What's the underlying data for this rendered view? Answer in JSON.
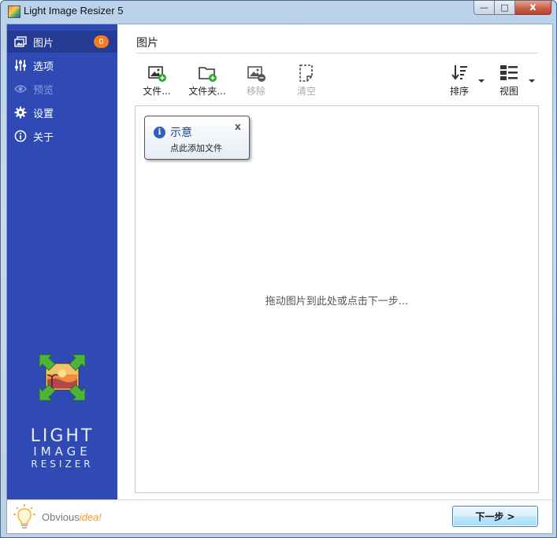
{
  "window": {
    "title": "Light Image Resizer 5",
    "minimize": "—",
    "maximize": "□",
    "close": "x"
  },
  "sidebar": {
    "items": [
      {
        "label": "图片",
        "icon": "images-icon",
        "badge": "0",
        "active": true
      },
      {
        "label": "选项",
        "icon": "sliders-icon"
      },
      {
        "label": "预览",
        "icon": "eye-icon",
        "disabled": true
      },
      {
        "label": "设置",
        "icon": "gear-icon"
      },
      {
        "label": "关于",
        "icon": "info-icon"
      }
    ],
    "logo": {
      "line1": "LIGHT",
      "line2": "IMAGE",
      "line3": "RESIZER"
    },
    "brand": {
      "part1": "Obvious",
      "part2": "idea!"
    }
  },
  "main": {
    "title": "图片",
    "toolbar": {
      "files": "文件...",
      "folder": "文件夹...",
      "remove": "移除",
      "clear": "清空",
      "sort": "排序",
      "view": "视图"
    },
    "drop_hint": "拖动图片到此处或点击下一步...",
    "tooltip": {
      "title": "示意",
      "body": "点此添加文件",
      "close": "x"
    },
    "next_button": "下一步 >"
  },
  "colors": {
    "sidebar": "#2f49b5",
    "sidebar_active": "#243a93",
    "badge": "#f47c20",
    "accent_green": "#2aa52a"
  }
}
